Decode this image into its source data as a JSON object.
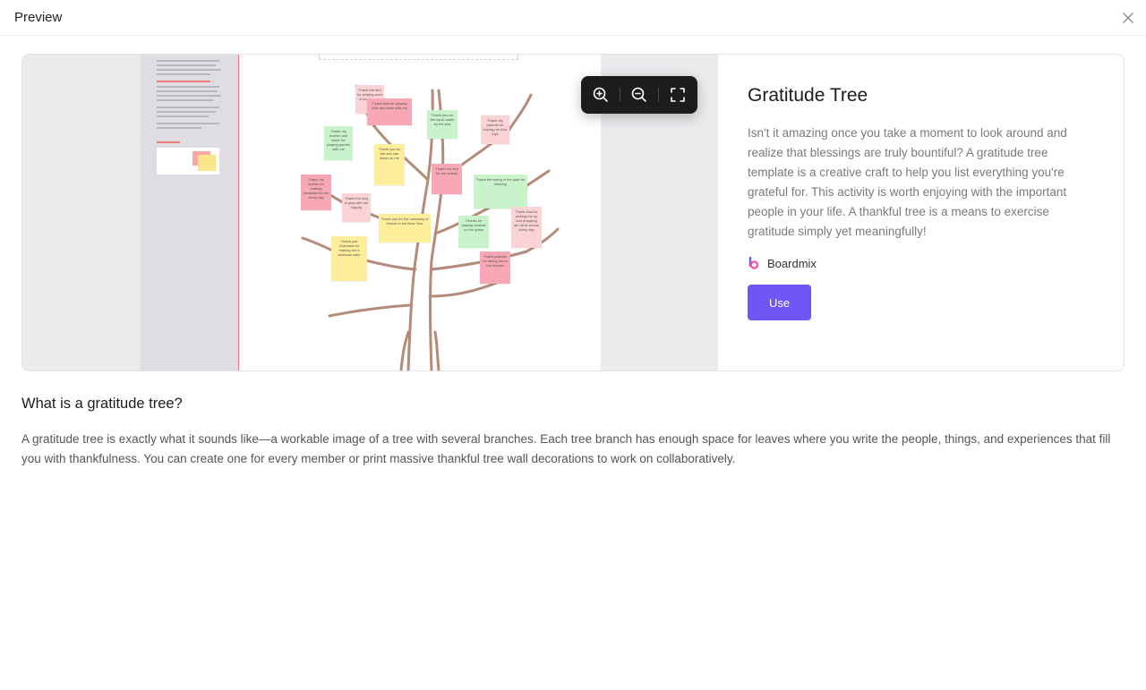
{
  "header": {
    "title": "Preview"
  },
  "icons": {
    "close": "close-icon",
    "zoom_in": "zoom-in-icon",
    "zoom_out": "zoom-out-icon",
    "fullscreen": "fullscreen-icon",
    "brand": "boardmix-logo-icon"
  },
  "preview": {
    "notes": [
      {
        "text": "Thank the bird for singing such a lovely song",
        "color": "lpink"
      },
      {
        "text": "Thank kids for playing hide and seek with me",
        "color": "pink"
      },
      {
        "text": "Thank you for the sand castle by the sea",
        "color": "green"
      },
      {
        "text": "Thank my parents for buying me nice toys",
        "color": "lpink"
      },
      {
        "text": "Thank my brother and sister for playing games with me",
        "color": "green"
      },
      {
        "text": "Thank you for the sun can shine on me",
        "color": "yellow"
      },
      {
        "text": "Thank the sea for the beauty",
        "color": "pink"
      },
      {
        "text": "Thank the swing in the park for relaxing",
        "color": "green"
      },
      {
        "text": "Thank my mother for making breakfast for me every day",
        "color": "pink"
      },
      {
        "text": "Thank the dog to play with me happily",
        "color": "lpink"
      },
      {
        "text": "Thank you for the company of friends in the New Year",
        "color": "yellow"
      },
      {
        "text": "Thanks for playing football on the grass",
        "color": "green"
      },
      {
        "text": "Thank Dad for picking me up and dropping me off at school every day",
        "color": "lpink"
      },
      {
        "text": "Thank you Grandma for making me a delicious cake",
        "color": "yellow"
      },
      {
        "text": "Thank parents for taking me to the movies",
        "color": "pink"
      }
    ]
  },
  "template": {
    "title": "Gratitude Tree",
    "description": "Isn't it amazing once you take a moment to look around and realize that blessings are truly bountiful? A gratitude tree template is a creative craft to help you list everything you're grateful for. This activity is worth enjoying with the important people in your life. A thankful tree is a means to exercise gratitude simply yet meaningfully!",
    "brand": "Boardmix",
    "use_label": "Use",
    "accent_color": "#7255f6"
  },
  "section": {
    "title": "What is a gratitude tree?",
    "body": "A gratitude tree is exactly what it sounds like—a workable image of a tree with several branches. Each tree branch has enough space for leaves where you write the people, things, and experiences that fill you with thankfulness. You can create one for every member or print massive thankful tree wall decorations to work on collaboratively."
  }
}
